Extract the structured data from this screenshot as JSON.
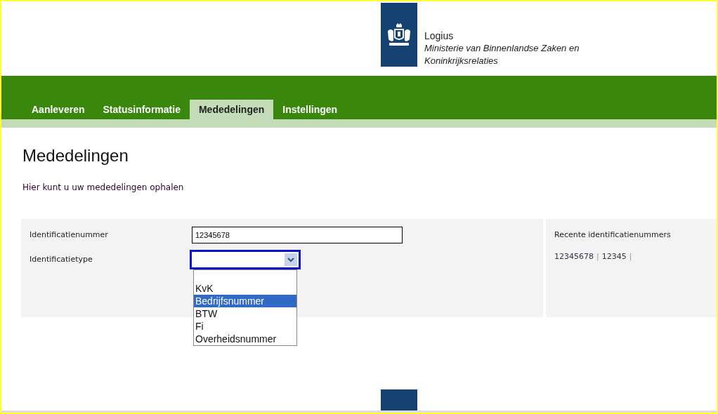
{
  "logo": {
    "name": "Logius",
    "ministry_line_1": "Ministerie van Binnenlandse Zaken en",
    "ministry_line_2": "Koninkrijksrelaties"
  },
  "tabs": [
    {
      "label": "Aanleveren",
      "selected": false
    },
    {
      "label": "Statusinformatie",
      "selected": false
    },
    {
      "label": "Mededelingen",
      "selected": true
    },
    {
      "label": "Instellingen",
      "selected": false
    }
  ],
  "page": {
    "title": "Mededelingen",
    "intro": "Hier kunt u uw mededelingen ophalen"
  },
  "form": {
    "id_label": "Identificatienummer",
    "id_value": "12345678",
    "type_label": "Identificatietype",
    "type_options": [
      {
        "label": "KvK",
        "selected": false
      },
      {
        "label": "Bedrijfsnummer",
        "selected": true
      },
      {
        "label": "BTW",
        "selected": false
      },
      {
        "label": "Fi",
        "selected": false
      },
      {
        "label": "Overheidsnummer",
        "selected": false
      }
    ]
  },
  "recent": {
    "title": "Recente identificatienummers",
    "items": [
      "12345678",
      "12345"
    ],
    "separator": "|"
  }
}
